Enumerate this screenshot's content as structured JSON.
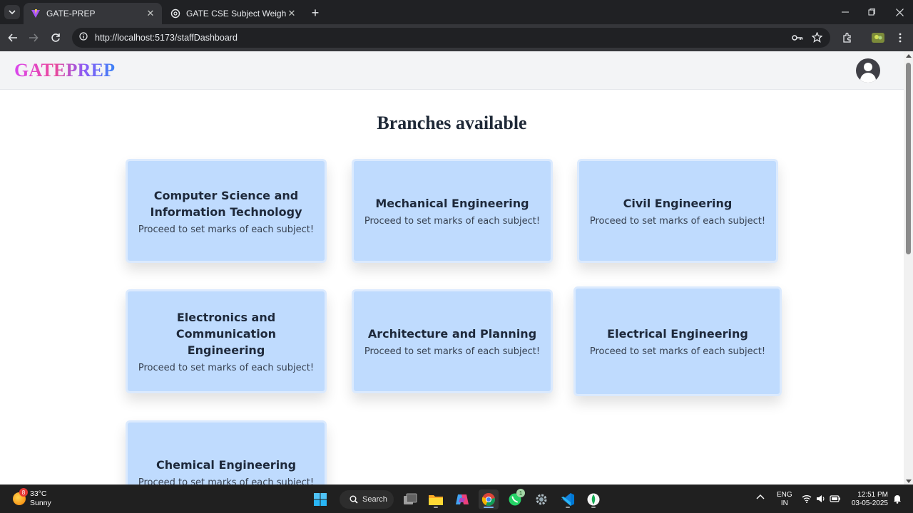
{
  "browser": {
    "tabs": [
      {
        "title": "GATE-PREP",
        "active": true,
        "favicon": "vite-logo-icon"
      },
      {
        "title": "GATE CSE Subject Weightage",
        "active": false,
        "favicon": "openai-logo-icon"
      }
    ],
    "url": "http://localhost:5173/staffDashboard"
  },
  "app": {
    "logo": "GATEPREP",
    "page_title": "Branches available",
    "card_subtitle": "Proceed to set marks of each subject!",
    "branches": [
      {
        "name": "Computer Science and Information Technology"
      },
      {
        "name": "Mechanical Engineering"
      },
      {
        "name": "Civil Engineering"
      },
      {
        "name": "Electronics and Communication Engineering"
      },
      {
        "name": "Architecture and Planning"
      },
      {
        "name": "Electrical Engineering"
      },
      {
        "name": "Chemical Engineering"
      }
    ]
  },
  "taskbar": {
    "weather": {
      "temp": "33°C",
      "condition": "Sunny",
      "badge": "8"
    },
    "search_label": "Search",
    "whatsapp_badge": "1",
    "language": {
      "line1": "ENG",
      "line2": "IN"
    },
    "time": "12:51 PM",
    "date": "03-05-2025"
  },
  "colors": {
    "card_bg": "#bfdbfe",
    "card_border": "#dbeafe",
    "nav_bg": "#f3f4f6",
    "title_text": "#1f2937"
  }
}
